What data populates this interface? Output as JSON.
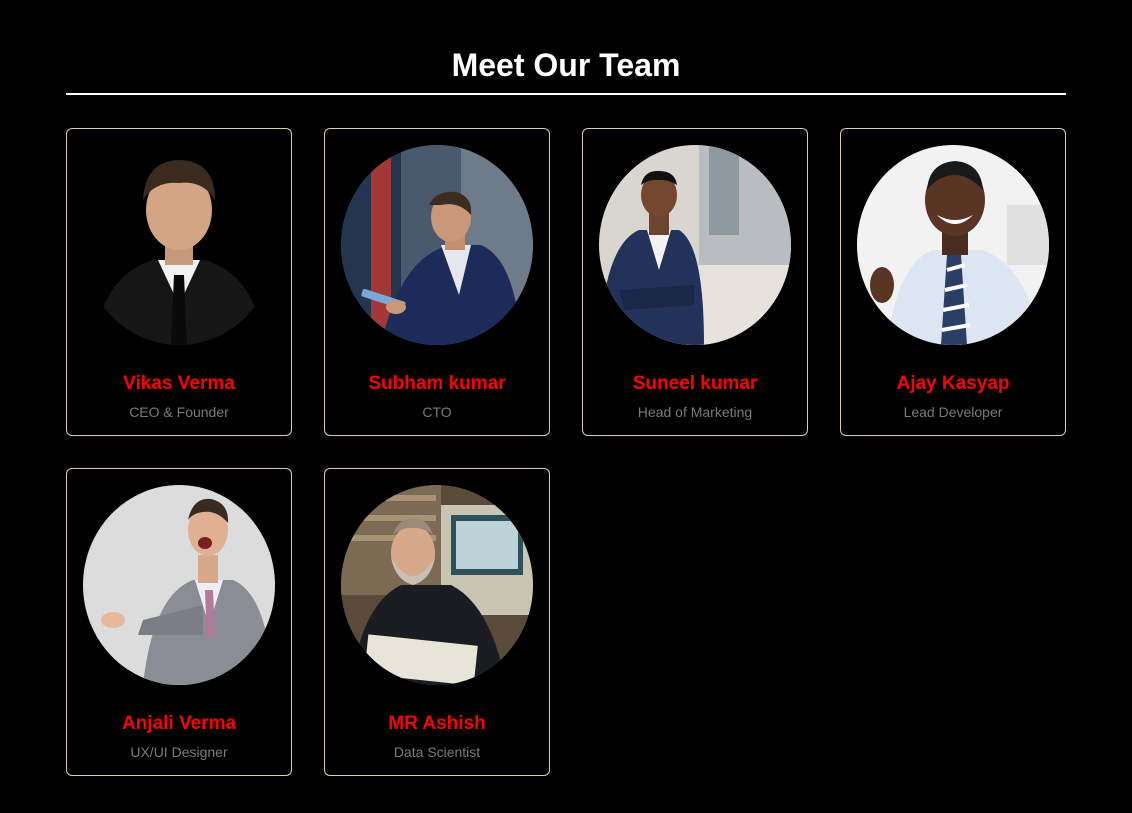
{
  "page": {
    "title": "Meet Our Team"
  },
  "team": [
    {
      "name": "Vikas Verma",
      "role": "CEO & Founder",
      "photo": "portrait-man-black-suit"
    },
    {
      "name": "Subham kumar",
      "role": "CTO",
      "photo": "portrait-man-tablet-building"
    },
    {
      "name": "Suneel kumar",
      "role": "Head of Marketing",
      "photo": "portrait-man-arms-crossed-street"
    },
    {
      "name": "Ajay Kasyap",
      "role": "Lead Developer",
      "photo": "portrait-man-smiling-tie"
    },
    {
      "name": "Anjali Verma",
      "role": "UX/UI Designer",
      "photo": "portrait-man-grey-suit-excited"
    },
    {
      "name": "MR Ashish",
      "role": "Data Scientist",
      "photo": "portrait-man-beard-computer"
    }
  ],
  "colors": {
    "background": "#000000",
    "name": "#ff0000",
    "role": "#7a7a7a",
    "card_border": "#d9ccb0"
  }
}
